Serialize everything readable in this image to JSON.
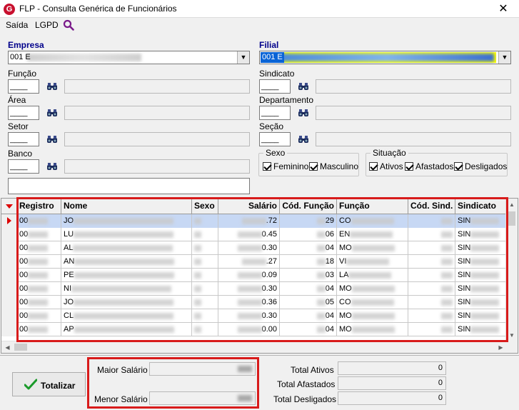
{
  "window": {
    "title": "FLP - Consulta Genérica de Funcionários",
    "close": "✕",
    "icon_letter": "G"
  },
  "menu": {
    "items": [
      "Saída",
      "LGPD"
    ]
  },
  "filters": {
    "empresa_label": "Empresa",
    "empresa_value": "001 E",
    "filial_label": "Filial",
    "filial_value": "001 E",
    "funcao_label": "Função",
    "area_label": "Área",
    "setor_label": "Setor",
    "banco_label": "Banco",
    "sindicato_label": "Sindicato",
    "departamento_label": "Departamento",
    "secao_label": "Seção",
    "code_placeholder": "____"
  },
  "sexo": {
    "title": "Sexo",
    "feminino": "Feminino",
    "masculino": "Masculino"
  },
  "situacao": {
    "title": "Situação",
    "ativos": "Ativos",
    "afastados": "Afastados",
    "desligados": "Desligados"
  },
  "grid": {
    "columns": [
      "Registro",
      "Nome",
      "Sexo",
      "Salário",
      "Cód. Função",
      "Função",
      "Cód. Sind.",
      "Sindicato"
    ],
    "rows": [
      {
        "registro": "00",
        "nome": "JO",
        "salario": ".72",
        "cod_funcao": "29",
        "funcao": "CO",
        "sindicato": "SIN"
      },
      {
        "registro": "00",
        "nome": "LU",
        "salario": "0.45",
        "cod_funcao": "06",
        "funcao": "EN",
        "sindicato": "SIN"
      },
      {
        "registro": "00",
        "nome": "AL",
        "salario": "0.30",
        "cod_funcao": "04",
        "funcao": "MO",
        "sindicato": "SIN"
      },
      {
        "registro": "00",
        "nome": "AN",
        "salario": ".27",
        "cod_funcao": "18",
        "funcao": "VI",
        "sindicato": "SIN"
      },
      {
        "registro": "00",
        "nome": "PE",
        "salario": "0.09",
        "cod_funcao": "03",
        "funcao": "LA",
        "sindicato": "SIN"
      },
      {
        "registro": "00",
        "nome": "NI",
        "salario": "0.30",
        "cod_funcao": "04",
        "funcao": "MO",
        "sindicato": "SIN"
      },
      {
        "registro": "00",
        "nome": "JO",
        "salario": "0.36",
        "cod_funcao": "05",
        "funcao": "CO",
        "sindicato": "SIN"
      },
      {
        "registro": "00",
        "nome": "CL",
        "salario": "0.30",
        "cod_funcao": "04",
        "funcao": "MO",
        "sindicato": "SIN"
      },
      {
        "registro": "00",
        "nome": "AP",
        "salario": "0.00",
        "cod_funcao": "04",
        "funcao": "MO",
        "sindicato": "SIN"
      }
    ]
  },
  "totals": {
    "button": "Totalizar",
    "maior_label": "Maior Salário",
    "menor_label": "Menor Salário",
    "ativos_label": "Total Ativos",
    "afastados_label": "Total Afastados",
    "desligados_label": "Total Desligados",
    "ativos_value": "0",
    "afastados_value": "0",
    "desligados_value": "0"
  },
  "colors": {
    "highlight_red": "#d81b1b",
    "selected_row": "#c7d8f4",
    "label_blue": "#00008b"
  }
}
